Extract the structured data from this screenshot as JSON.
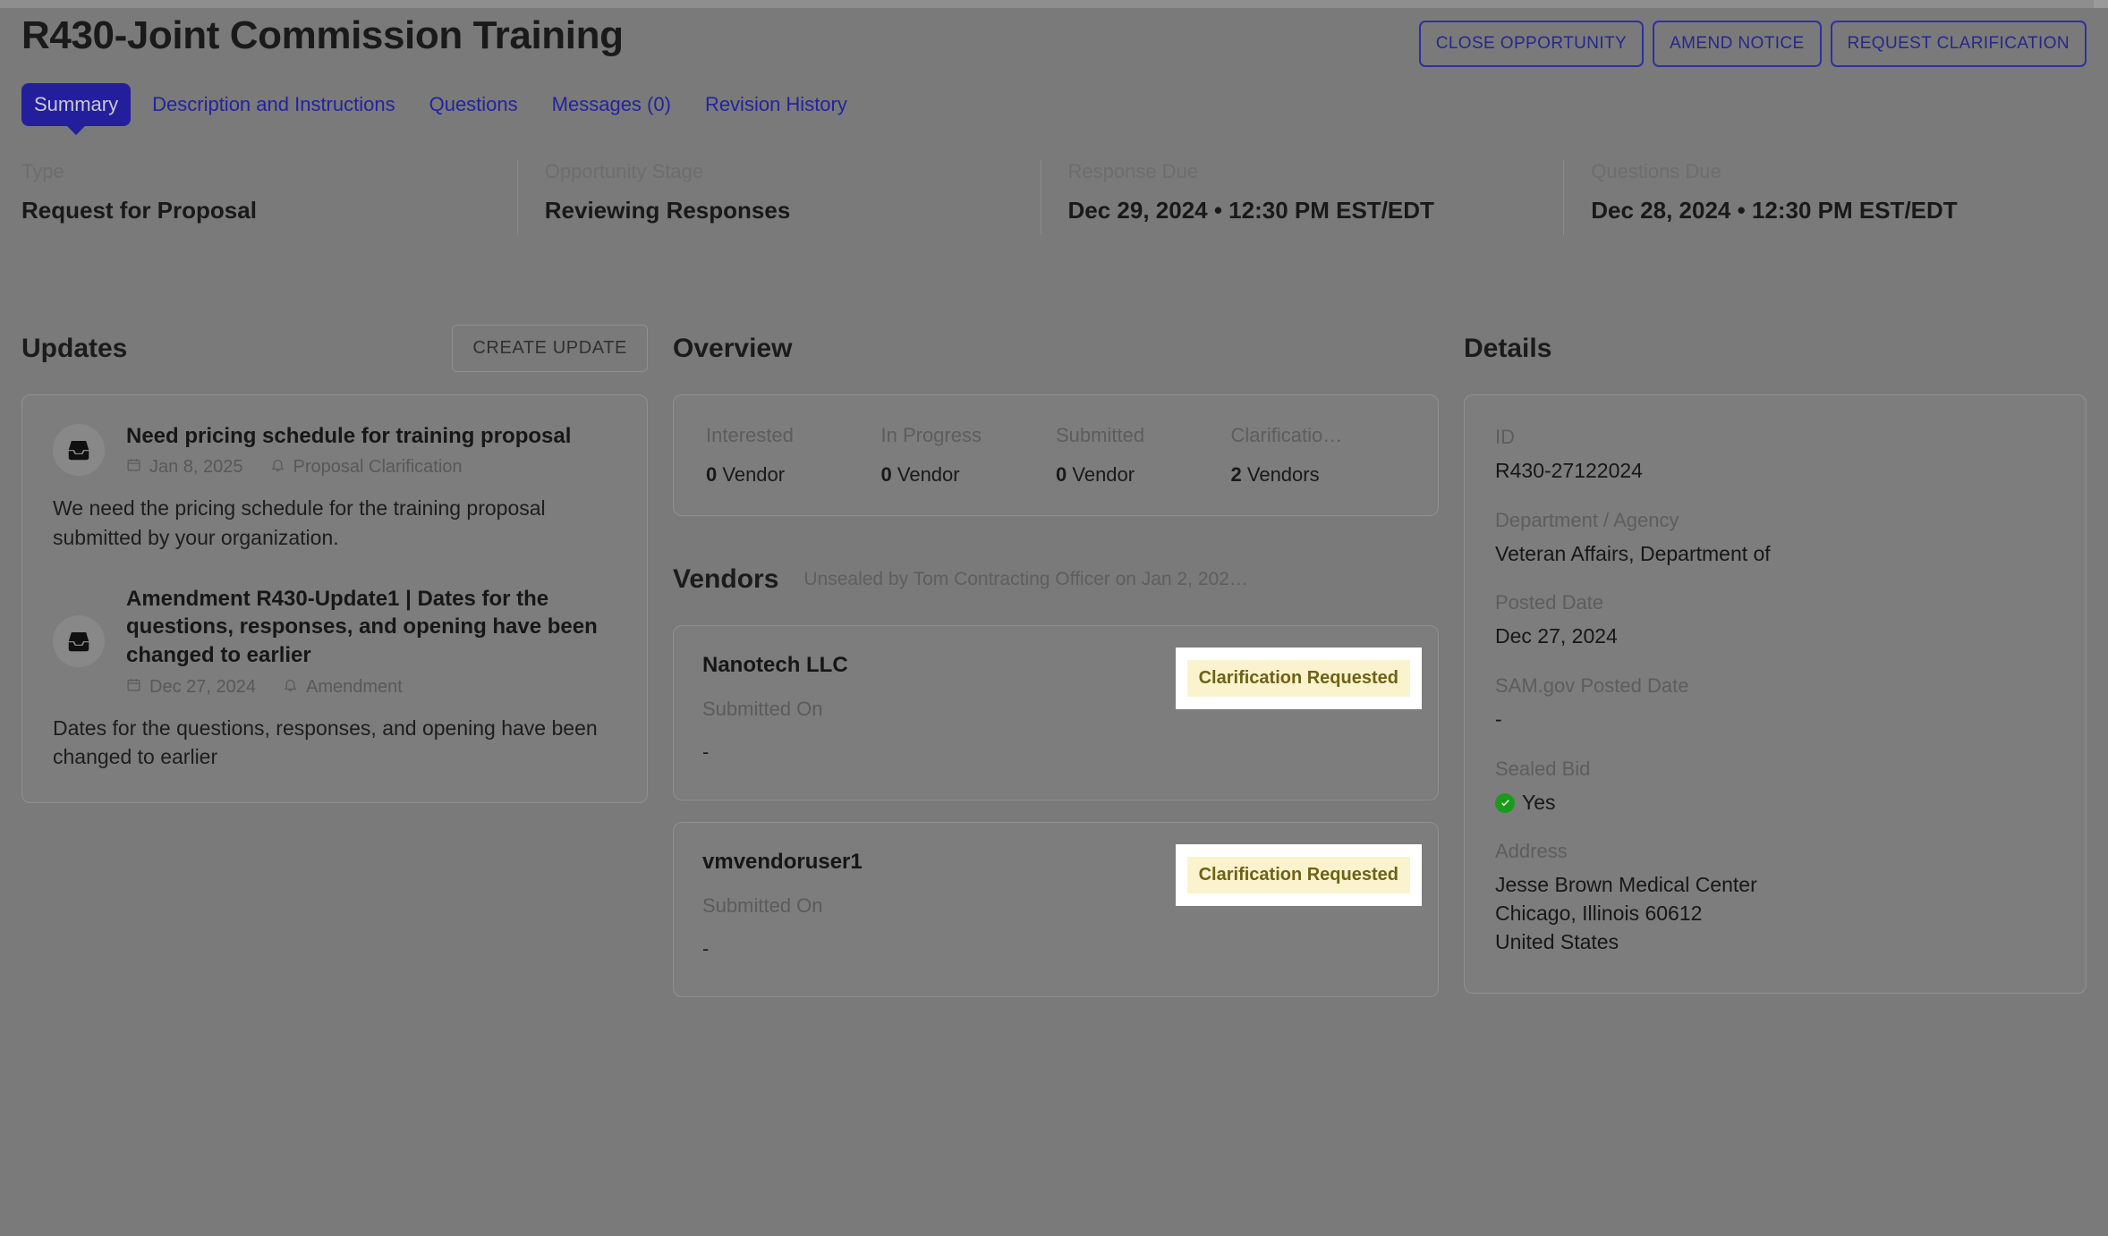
{
  "header": {
    "title": "R430-Joint Commission Training",
    "actions": [
      {
        "label": "CLOSE OPPORTUNITY",
        "name": "close-opportunity-button"
      },
      {
        "label": "AMEND NOTICE",
        "name": "amend-notice-button"
      },
      {
        "label": "REQUEST CLARIFICATION",
        "name": "request-clarification-button"
      }
    ]
  },
  "tabs": [
    {
      "label": "Summary",
      "active": true
    },
    {
      "label": "Description and Instructions",
      "active": false
    },
    {
      "label": "Questions",
      "active": false
    },
    {
      "label": "Messages (0)",
      "active": false
    },
    {
      "label": "Revision History",
      "active": false
    }
  ],
  "meta": [
    {
      "label": "Type",
      "value": "Request for Proposal"
    },
    {
      "label": "Opportunity Stage",
      "value": "Reviewing Responses"
    },
    {
      "label": "Response Due",
      "value": "Dec 29, 2024 • 12:30 PM EST/EDT"
    },
    {
      "label": "Questions Due",
      "value": "Dec 28, 2024 • 12:30 PM EST/EDT"
    }
  ],
  "updates": {
    "title": "Updates",
    "create_button": "CREATE UPDATE",
    "items": [
      {
        "icon": "inbox-icon",
        "title": "Need pricing schedule for training proposal",
        "date": "Jan 8, 2025",
        "category": "Proposal Clarification",
        "body": "We need the pricing schedule for the training proposal submitted by your organization."
      },
      {
        "icon": "inbox-icon",
        "title": "Amendment R430-Update1 | Dates for the questions, responses, and opening have been changed to earlier",
        "date": "Dec 27, 2024",
        "category": "Amendment",
        "body": "Dates for the questions, responses, and opening have been changed to earlier"
      }
    ]
  },
  "overview": {
    "title": "Overview",
    "stats": [
      {
        "label": "Interested",
        "count": "0",
        "unit": "Vendor"
      },
      {
        "label": "In Progress",
        "count": "0",
        "unit": "Vendor"
      },
      {
        "label": "Submitted",
        "count": "0",
        "unit": "Vendor"
      },
      {
        "label": "Clarificatio…",
        "count": "2",
        "unit": "Vendors"
      }
    ]
  },
  "vendors": {
    "title": "Vendors",
    "unsealed_note": "Unsealed by Tom Contracting Officer on Jan 2, 202…",
    "submitted_on_label": "Submitted On",
    "items": [
      {
        "name": "Nanotech LLC",
        "submitted_on": "-",
        "status": "Clarification Requested"
      },
      {
        "name": "vmvendoruser1",
        "submitted_on": "-",
        "status": "Clarification Requested"
      }
    ]
  },
  "details": {
    "title": "Details",
    "fields": [
      {
        "label": "ID",
        "value": "R430-27122024"
      },
      {
        "label": "Department / Agency",
        "value": "Veteran Affairs, Department of"
      },
      {
        "label": "Posted Date",
        "value": "Dec 27, 2024"
      },
      {
        "label": "SAM.gov Posted Date",
        "value": "-"
      },
      {
        "label": "Sealed Bid",
        "value": "Yes",
        "icon": "check-circle-icon"
      },
      {
        "label": "Address",
        "value": "Jesse Brown Medical Center\nChicago, Illinois 60612\nUnited States"
      }
    ]
  },
  "colors": {
    "accent_blue": "#231f9c",
    "link_blue": "#2323a0",
    "badge_bg": "#faf3cd",
    "badge_text": "#6d6216",
    "success_green": "#1a9c1a",
    "overlay_gray": "#7a7a7a"
  }
}
